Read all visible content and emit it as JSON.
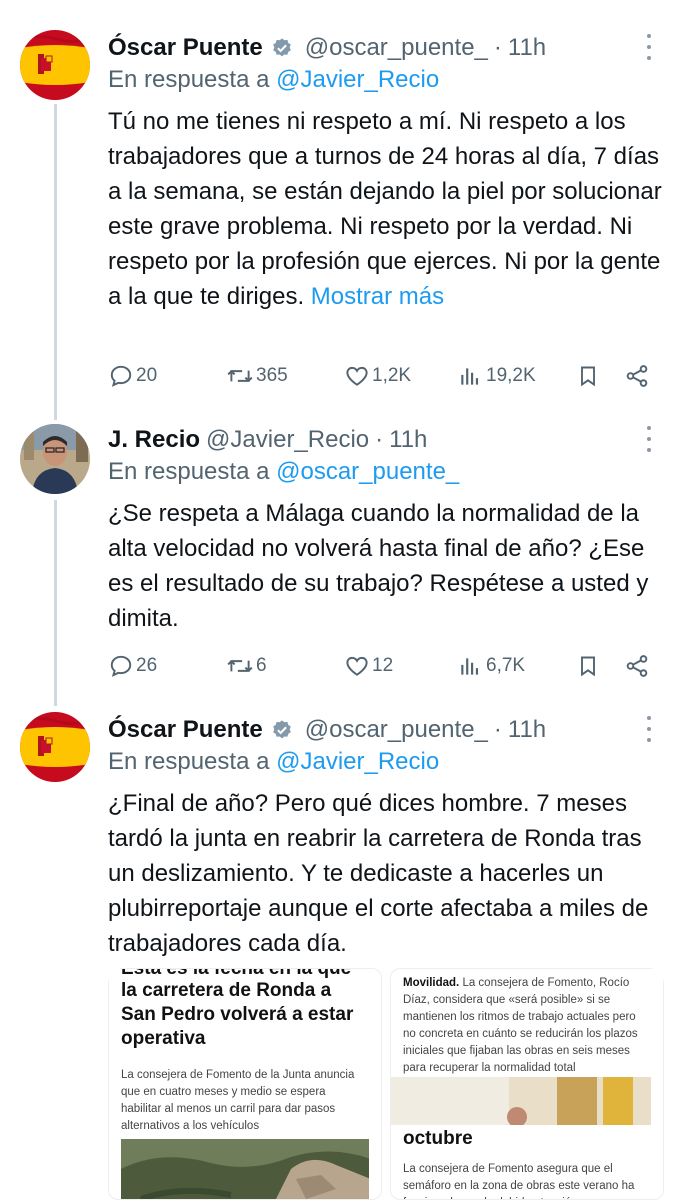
{
  "tweets": [
    {
      "name": "Óscar Puente",
      "handle": "@oscar_puente_",
      "dot": "·",
      "time": "11h",
      "reply_prefix": "En respuesta a ",
      "reply_to": "@Javier_Recio",
      "text": "Tú no me tienes ni respeto a mí. Ni respeto a los trabajadores que a turnos de 24 horas al día, 7 días a la semana, se están dejando la piel por solucionar este grave problema. Ni respeto por la verdad. Ni respeto por la profesión que ejerces. Ni por la gente a la que te diriges.",
      "show_more": "Mostrar más",
      "avatar_icon": "spain-flag-avatar",
      "verified": true,
      "stats": {
        "replies": "20",
        "reposts": "365",
        "likes": "1,2K",
        "views": "19,2K"
      }
    },
    {
      "name": "J. Recio",
      "handle": "@Javier_Recio",
      "dot": "·",
      "time": "11h",
      "reply_prefix": "En respuesta a ",
      "reply_to": "@oscar_puente_",
      "text": "¿Se respeta a Málaga cuando la normalidad de la alta velocidad no volverá hasta final de año? ¿Ese es el resultado de su trabajo? Respétese a usted y dimita.",
      "avatar_icon": "profile-photo-avatar",
      "verified": false,
      "stats": {
        "replies": "26",
        "reposts": "6",
        "likes": "12",
        "views": "6,7K"
      }
    },
    {
      "name": "Óscar Puente",
      "handle": "@oscar_puente_",
      "dot": "·",
      "time": "11h",
      "reply_prefix": "En respuesta a ",
      "reply_to": "@Javier_Recio",
      "text": "¿Final de año? Pero qué dices hombre. 7 meses tardó la junta en reabrir la carretera de Ronda tras un deslizamiento. Y te dedicaste a hacerles un plubirreportaje aunque el corte afectaba a miles de trabajadores cada día.",
      "avatar_icon": "spain-flag-avatar",
      "verified": true
    }
  ],
  "media": {
    "left": {
      "top_cut_line": "Esta es la fecha en la que",
      "headline": "la carretera de Ronda a San Pedro volverá a estar operativa",
      "lead": "La consejera de Fomento de la Junta anuncia que en cuatro meses y medio se espera habilitar al menos un carril para dar pasos alternativos a los vehículos"
    },
    "right": {
      "section": "Movilidad.",
      "lead": "La consejera de Fomento, Rocío Díaz, considera que «será posible» si se mantienen los ritmos de trabajo actuales pero no concreta en cuánto se reducirán los plazos iniciales que fijaban las obras en seis meses para recuperar la normalidad total",
      "headline": "octubre",
      "sub": "La consejera de Fomento asegura que el semáforo en la zona de obras este verano ha funcionado con la debida atención"
    }
  },
  "colors": {
    "accent": "#1d9bf0",
    "muted": "#536471",
    "text": "#0f1419",
    "verified": "#829aab"
  }
}
